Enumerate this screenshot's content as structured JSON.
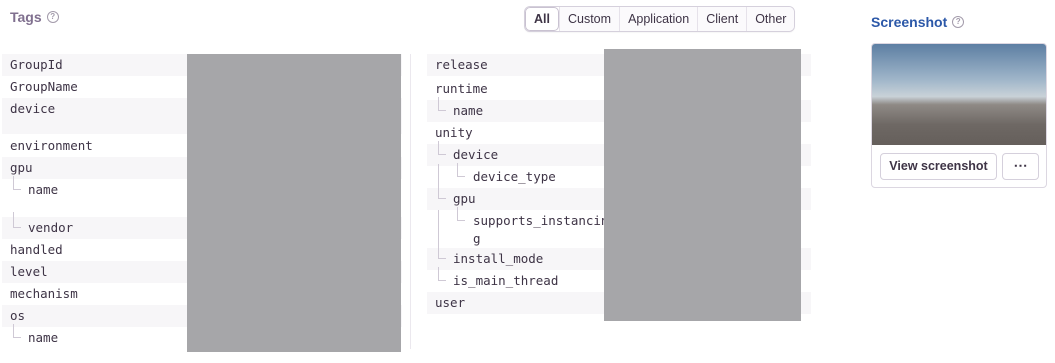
{
  "tags_section": {
    "title": "Tags",
    "help_icon": "question-circle-icon",
    "filter_tabs": [
      "All",
      "Custom",
      "Application",
      "Client",
      "Other"
    ],
    "active_filter": "All"
  },
  "left_table": {
    "rows": [
      "GroupId",
      "GroupName",
      "device",
      "environment",
      "gpu",
      "name",
      "vendor",
      "handled",
      "level",
      "mechanism",
      "os",
      "name"
    ]
  },
  "right_table": {
    "rows": [
      "release",
      "runtime",
      "name",
      "unity",
      "device",
      "device_type",
      "gpu",
      "supports_instancin",
      "g",
      "install_mode",
      "is_main_thread",
      "user"
    ]
  },
  "screenshot_section": {
    "title": "Screenshot",
    "help_icon": "question-circle-icon",
    "view_button_label": "View screenshot",
    "more_button_label": "⋯"
  }
}
